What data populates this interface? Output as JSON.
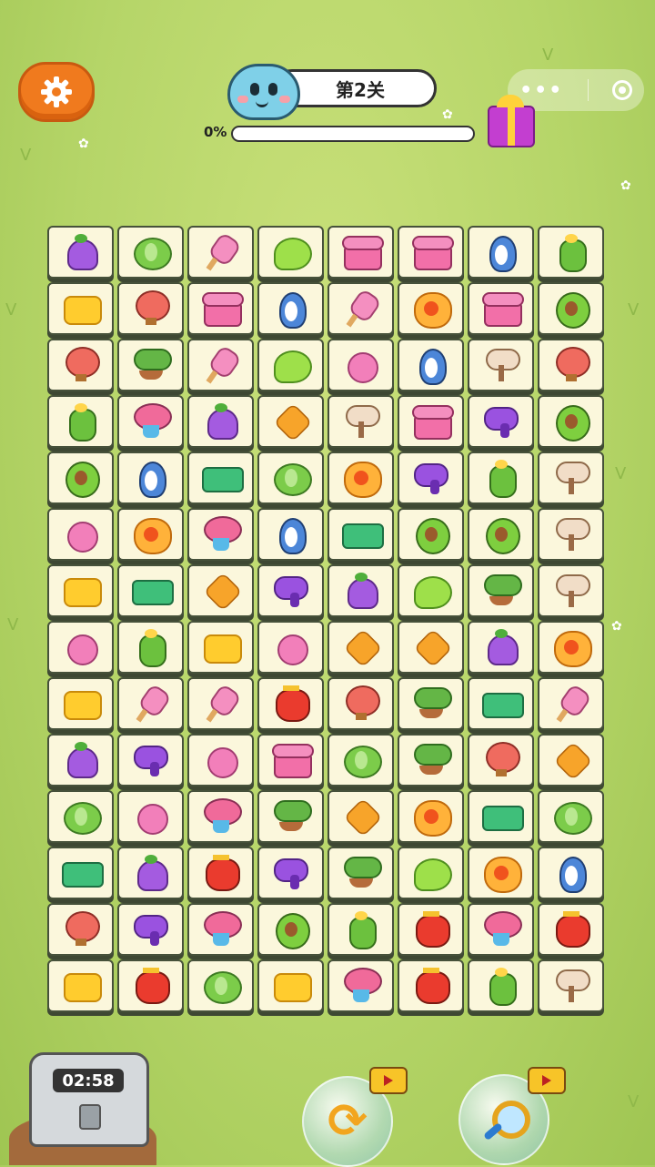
{
  "header": {
    "level_label": "第2关",
    "progress_text": "0%",
    "progress_value": 0
  },
  "timer": {
    "value": "02:58"
  },
  "colors": {
    "background": "#b5d568",
    "settings": "#f07a1e",
    "tile": "#fbf7dc",
    "progress": "#f29a2e"
  },
  "board": {
    "rows": [
      [
        "bell",
        "cabbage",
        "ice",
        "monstera",
        "phone",
        "phone",
        "penguin",
        "cactus"
      ],
      [
        "honey",
        "balloon",
        "phone",
        "penguin",
        "ice",
        "flower",
        "phone",
        "avocado"
      ],
      [
        "balloon",
        "bonsai",
        "ice",
        "monstera",
        "yarn",
        "penguin",
        "tree",
        "balloon"
      ],
      [
        "cactus",
        "bouquet",
        "bell",
        "maple",
        "tree",
        "phone",
        "dryer",
        "avocado"
      ],
      [
        "avocado",
        "penguin",
        "cloth",
        "cabbage",
        "flower",
        "dryer",
        "cactus",
        "tree"
      ],
      [
        "yarn",
        "flower",
        "bouquet",
        "penguin",
        "cloth",
        "avocado",
        "avocado",
        "tree"
      ],
      [
        "honey",
        "cloth",
        "maple",
        "dryer",
        "bell",
        "monstera",
        "bonsai",
        "tree"
      ],
      [
        "yarn",
        "cactus",
        "honey",
        "yarn",
        "maple",
        "maple",
        "bell",
        "flower"
      ],
      [
        "honey",
        "ice",
        "ice",
        "lantern",
        "balloon",
        "bonsai",
        "cloth",
        "ice"
      ],
      [
        "bell",
        "dryer",
        "yarn",
        "phone",
        "cabbage",
        "bonsai",
        "balloon",
        "maple"
      ],
      [
        "cabbage",
        "yarn",
        "bouquet",
        "bonsai",
        "maple",
        "flower",
        "cloth",
        "cabbage"
      ],
      [
        "cloth",
        "bell",
        "lantern",
        "dryer",
        "bonsai",
        "monstera",
        "flower",
        "penguin"
      ],
      [
        "balloon",
        "dryer",
        "bouquet",
        "avocado",
        "cactus",
        "lantern",
        "bouquet",
        "lantern"
      ],
      [
        "honey",
        "lantern",
        "cabbage",
        "honey",
        "bouquet",
        "lantern",
        "cactus",
        "tree"
      ]
    ]
  },
  "icons": {
    "settings": "gear-icon",
    "menu": "more-dots-icon",
    "close": "target-icon",
    "gift": "gift-icon",
    "shuffle": "shuffle-icon",
    "hint": "magnifier-icon",
    "video": "video-icon"
  }
}
